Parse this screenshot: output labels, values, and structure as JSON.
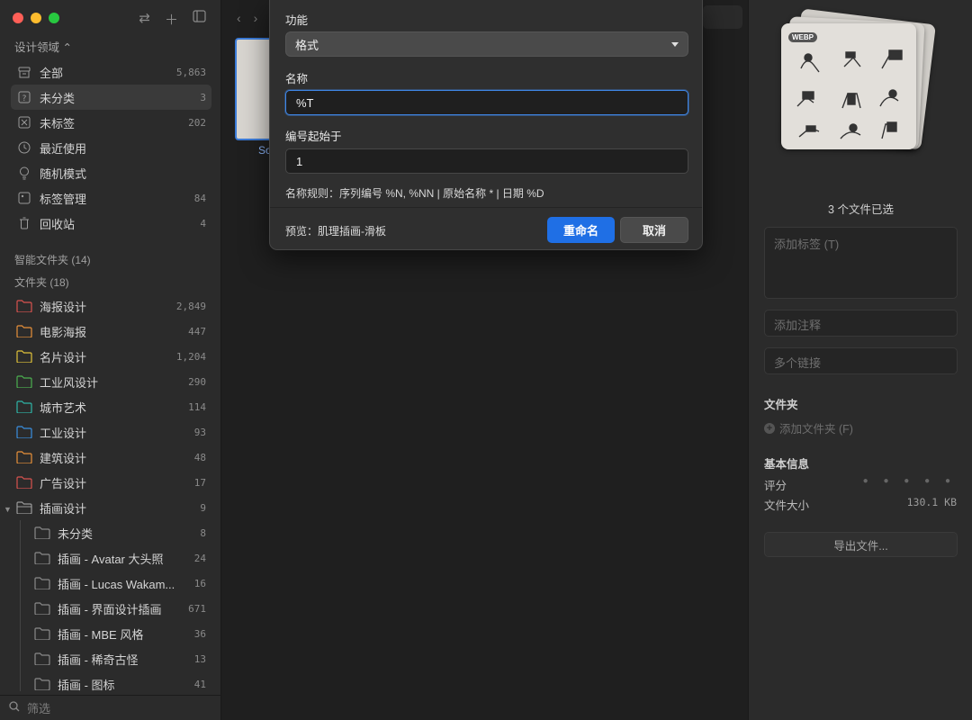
{
  "sidebar": {
    "workspace": "设计领域 ⌃",
    "nav": [
      {
        "label": "全部",
        "count": "5,863",
        "icon": "archive-icon"
      },
      {
        "label": "未分类",
        "count": "3",
        "icon": "unsorted-icon"
      },
      {
        "label": "未标签",
        "count": "202",
        "icon": "untagged-icon"
      },
      {
        "label": "最近使用",
        "count": "",
        "icon": "clock-icon"
      },
      {
        "label": "随机模式",
        "count": "",
        "icon": "bulb-icon"
      },
      {
        "label": "标签管理",
        "count": "84",
        "icon": "tag-icon"
      },
      {
        "label": "回收站",
        "count": "4",
        "icon": "trash-icon"
      }
    ],
    "smart_folders": "智能文件夹 (14)",
    "folders_title": "文件夹 (18)",
    "folders": [
      {
        "label": "海报设计",
        "count": "2,849",
        "color": "#d9534f"
      },
      {
        "label": "电影海报",
        "count": "447",
        "color": "#e8913a"
      },
      {
        "label": "名片设计",
        "count": "1,204",
        "color": "#e0c23a"
      },
      {
        "label": "工业风设计",
        "count": "290",
        "color": "#4cb050"
      },
      {
        "label": "城市艺术",
        "count": "114",
        "color": "#2fb5a7"
      },
      {
        "label": "工业设计",
        "count": "93",
        "color": "#3a8fe0"
      },
      {
        "label": "建筑设计",
        "count": "48",
        "color": "#e8913a"
      },
      {
        "label": "广告设计",
        "count": "17",
        "color": "#d9534f"
      },
      {
        "label": "插画设计",
        "count": "9",
        "color": "#9a9a9a"
      }
    ],
    "subfolders": [
      {
        "label": "未分类",
        "count": "8"
      },
      {
        "label": "插画 - Avatar 大头照",
        "count": "24"
      },
      {
        "label": "插画 - Lucas Wakam...",
        "count": "16"
      },
      {
        "label": "插画 - 界面设计插画",
        "count": "671"
      },
      {
        "label": "插画 - MBE 风格",
        "count": "36"
      },
      {
        "label": "插画 - 稀奇古怪",
        "count": "13"
      },
      {
        "label": "插画 - 图标",
        "count": "41"
      }
    ],
    "filter_placeholder": "筛选"
  },
  "main": {
    "thumb_label": "So"
  },
  "dialog": {
    "function_label": "功能",
    "function_value": "格式",
    "name_label": "名称",
    "name_value": "%T",
    "start_label": "编号起始于",
    "start_value": "1",
    "rule_text": "名称规则：序列编号 %N, %NN | 原始名称 * | 日期 %D",
    "preview_text": "预览：肌理插画-滑板",
    "rename_button": "重命名",
    "cancel_button": "取消"
  },
  "inspector": {
    "badge": "WEBP",
    "selected": "3 个文件已选",
    "tags_placeholder": "添加标签 (T)",
    "note_placeholder": "添加注释",
    "links_placeholder": "多个链接",
    "folder_title": "文件夹",
    "add_folder": "添加文件夹 (F)",
    "info_title": "基本信息",
    "rating_label": "评分",
    "rating_stars": "● ● ● ● ●",
    "size_label": "文件大小",
    "size_value": "130.1 KB",
    "export_button": "导出文件..."
  }
}
